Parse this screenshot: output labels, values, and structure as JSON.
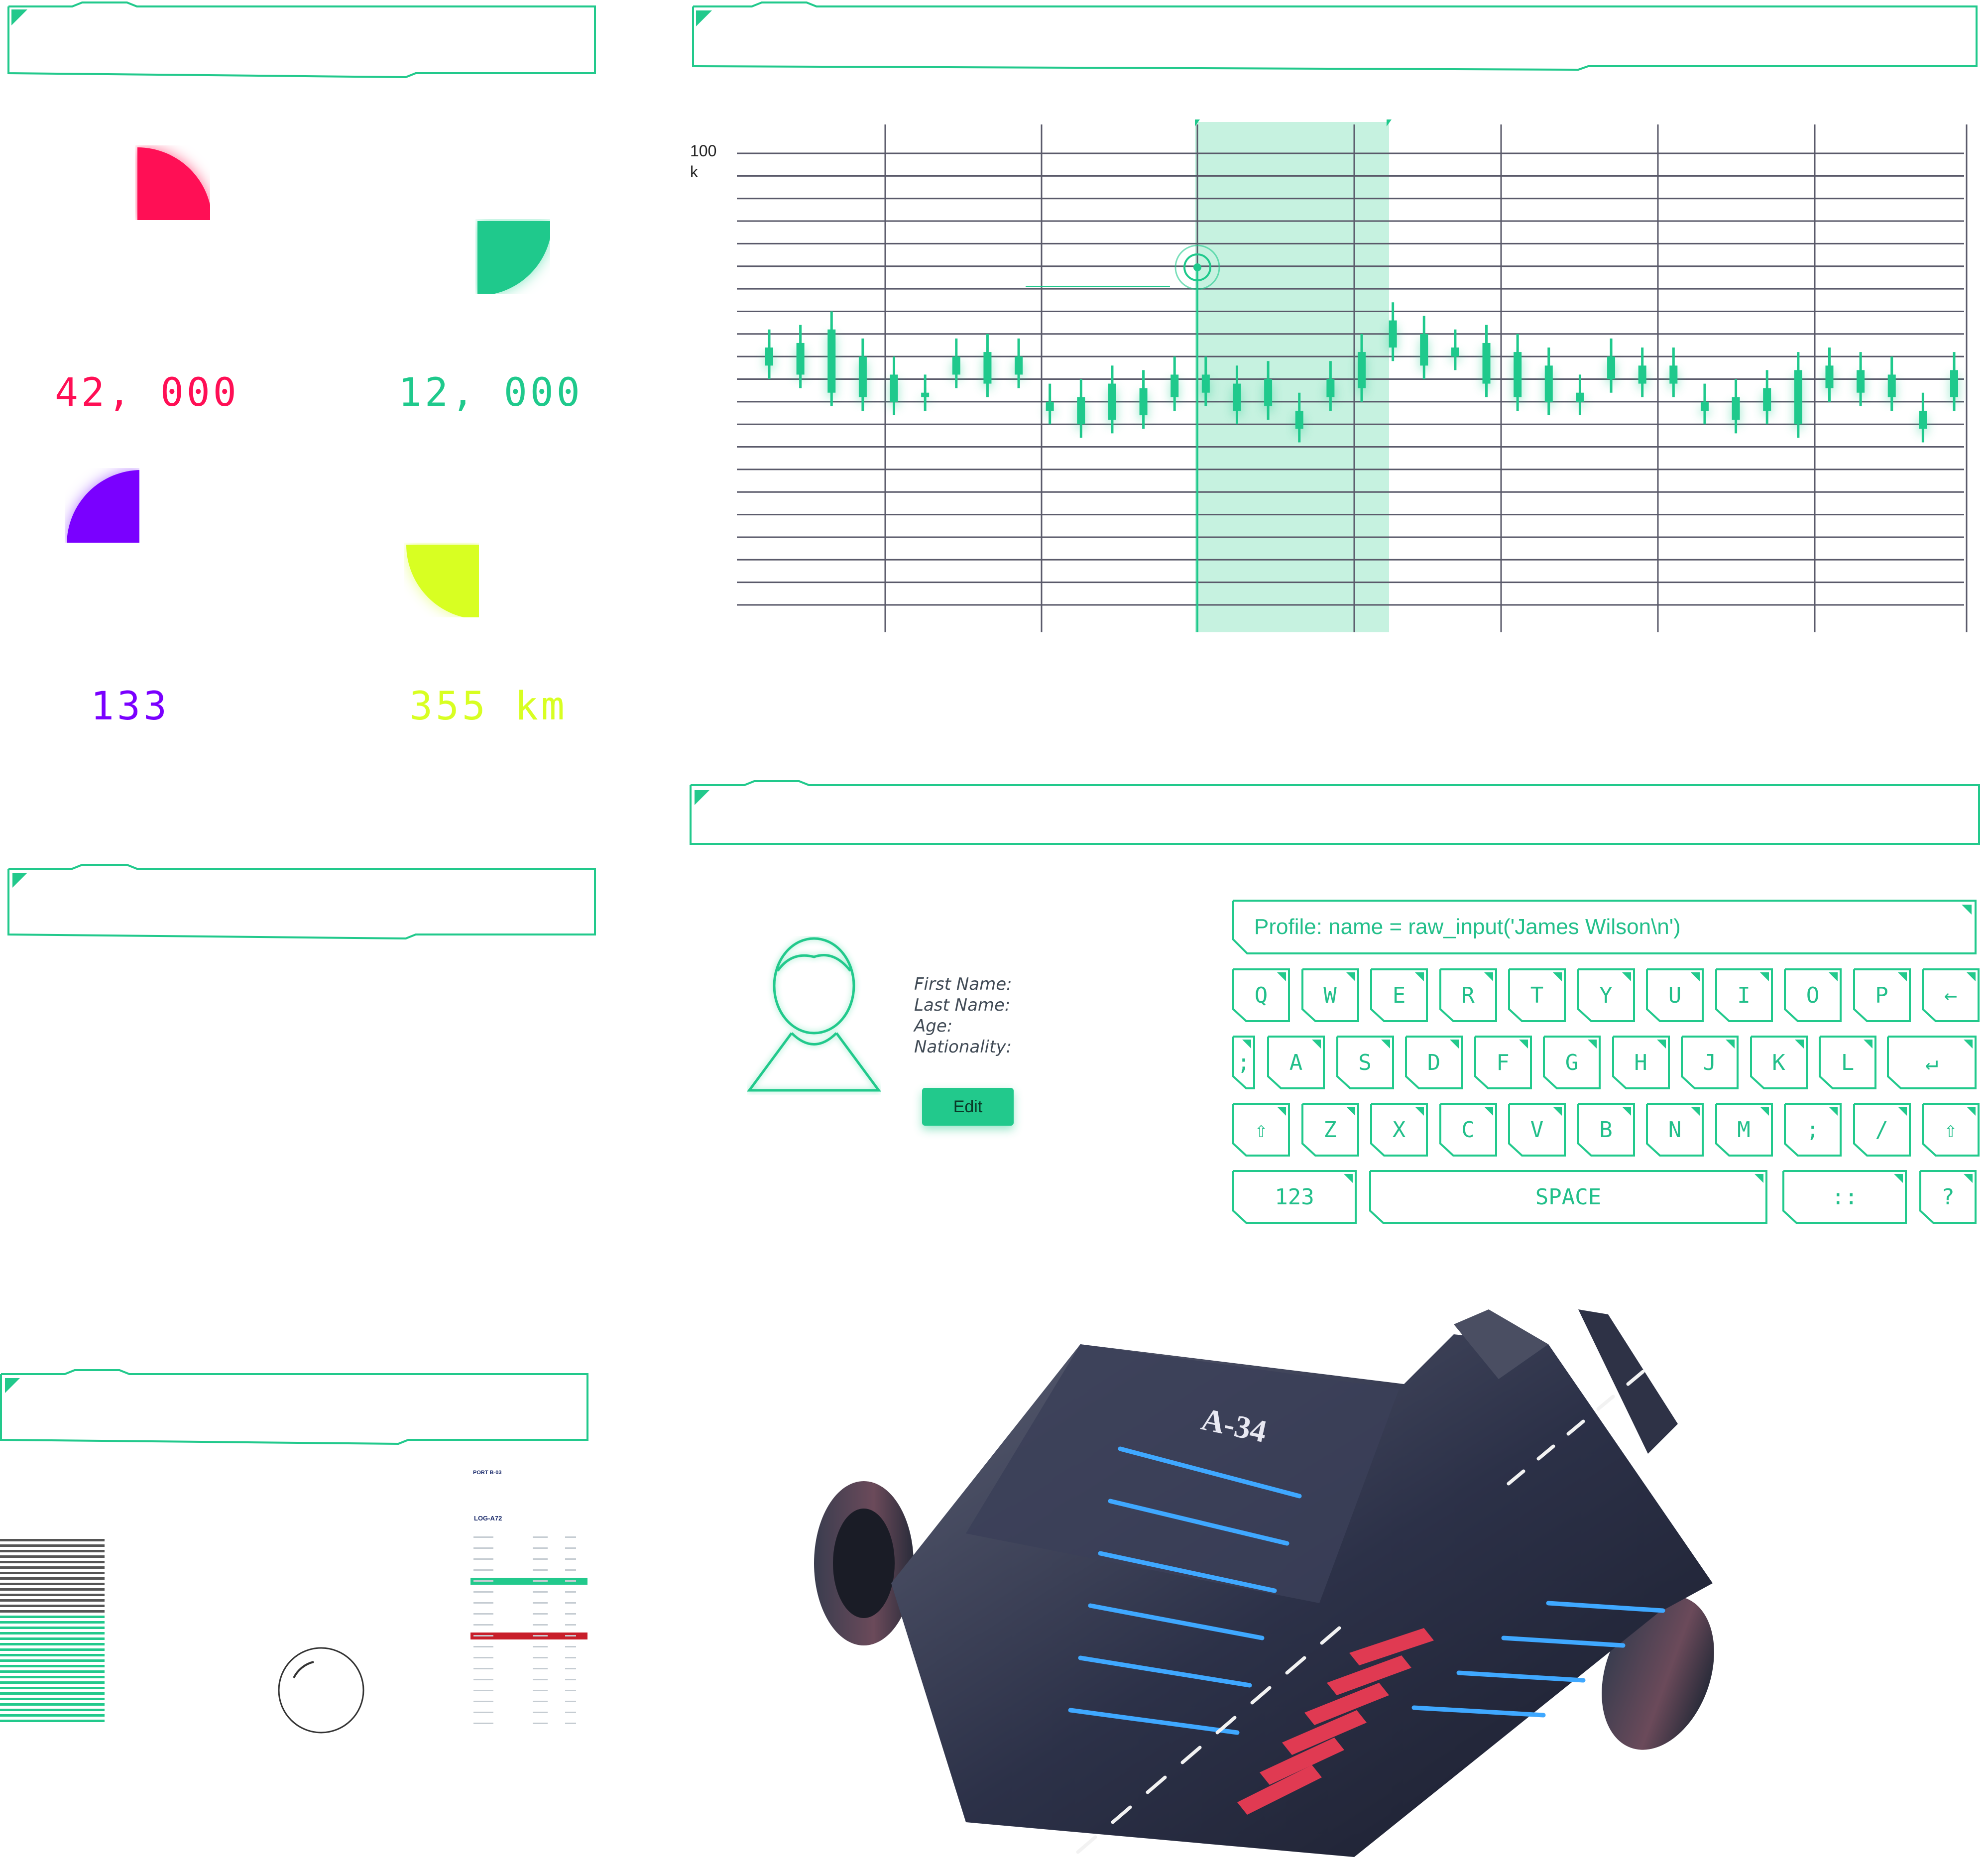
{
  "stats": [
    {
      "value": "42, 000",
      "color": "#ff0f55"
    },
    {
      "value": "12, 000",
      "color": "#1fc98c"
    },
    {
      "value": "133",
      "color": "#7a00ff"
    },
    {
      "value": "355 km",
      "color": "#d8ff22"
    }
  ],
  "chart": {
    "y_tick_label": "100",
    "y_tick_unit": "k",
    "accent": "#1fc98c",
    "grid_color": "#5a5a6a",
    "highlight_color": "#c6f2e0",
    "candles": [
      {
        "o": 53,
        "c": 57
      },
      {
        "o": 58,
        "c": 51
      },
      {
        "o": 61,
        "c": 47
      },
      {
        "o": 55,
        "c": 46
      },
      {
        "o": 51,
        "c": 45
      },
      {
        "o": 46,
        "c": 47
      },
      {
        "o": 51,
        "c": 55
      },
      {
        "o": 49,
        "c": 56
      },
      {
        "o": 51,
        "c": 55
      },
      {
        "o": 43,
        "c": 45
      },
      {
        "o": 46,
        "c": 40
      },
      {
        "o": 49,
        "c": 41
      },
      {
        "o": 48,
        "c": 42
      },
      {
        "o": 51,
        "c": 46
      },
      {
        "o": 47,
        "c": 51
      },
      {
        "o": 49,
        "c": 43
      },
      {
        "o": 50,
        "c": 44
      },
      {
        "o": 43,
        "c": 39
      },
      {
        "o": 50,
        "c": 46
      },
      {
        "o": 56,
        "c": 48
      },
      {
        "o": 63,
        "c": 57
      },
      {
        "o": 60,
        "c": 53
      },
      {
        "o": 55,
        "c": 57
      },
      {
        "o": 58,
        "c": 49
      },
      {
        "o": 56,
        "c": 46
      },
      {
        "o": 53,
        "c": 45
      },
      {
        "o": 47,
        "c": 45
      },
      {
        "o": 55,
        "c": 50
      },
      {
        "o": 53,
        "c": 49
      },
      {
        "o": 49,
        "c": 53
      },
      {
        "o": 43,
        "c": 45
      },
      {
        "o": 46,
        "c": 41
      },
      {
        "o": 48,
        "c": 43
      },
      {
        "o": 52,
        "c": 40
      },
      {
        "o": 48,
        "c": 53
      },
      {
        "o": 52,
        "c": 47
      },
      {
        "o": 51,
        "c": 46
      },
      {
        "o": 43,
        "c": 39
      },
      {
        "o": 52,
        "c": 46
      }
    ]
  },
  "profile": {
    "first_name_label": "First Name:",
    "last_name_label": "Last Name:",
    "age_label": "Age:",
    "nationality_label": "Nationality:",
    "edit_label": "Edit"
  },
  "keyboard": {
    "input_value": "Profile: name = raw_input('James Wilson\\n')",
    "row1": [
      "Q",
      "W",
      "E",
      "R",
      "T",
      "Y",
      "U",
      "I",
      "O",
      "P",
      "←"
    ],
    "row2": [
      ";",
      "A",
      "S",
      "D",
      "F",
      "G",
      "H",
      "J",
      "K",
      "L"
    ],
    "row2_enter": "↵",
    "row3": [
      "⇧",
      "Z",
      "X",
      "C",
      "V",
      "B",
      "N",
      "M",
      ";",
      "/",
      "⇧"
    ],
    "num_label": "123",
    "space_label": "SPACE",
    "grid_label": "::",
    "question_label": "?"
  },
  "log": {
    "port_label": "PORT B-03",
    "log_label": "LOG-A72"
  },
  "ship": {
    "hull_label": "A-34"
  }
}
